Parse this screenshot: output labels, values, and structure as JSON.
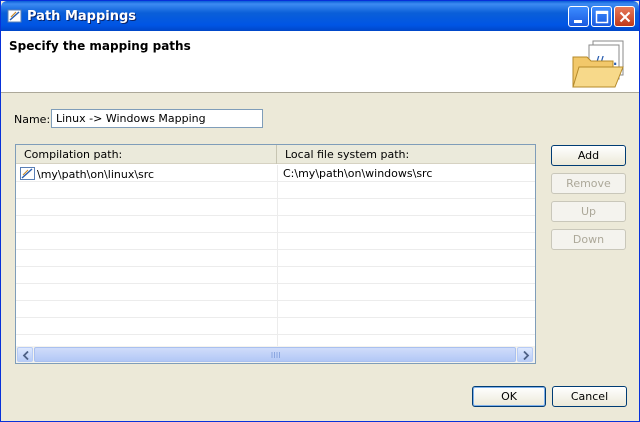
{
  "window": {
    "title": "Path Mappings",
    "icon": "path-mapping-app-icon",
    "controls": [
      "minimize-icon",
      "maximize-icon",
      "close-icon"
    ]
  },
  "banner": {
    "title": "Specify the mapping paths",
    "image": "folder-mapping-icon"
  },
  "name": {
    "label": "Name:",
    "value": "Linux -> Windows Mapping"
  },
  "table": {
    "columns": [
      "Compilation path:",
      "Local file system path:"
    ],
    "rows": [
      {
        "icon": "mapping-row-icon",
        "compilation": "\\my\\path\\on\\linux\\src",
        "local": "C:\\my\\path\\on\\windows\\src"
      },
      {
        "compilation": "",
        "local": ""
      },
      {
        "compilation": "",
        "local": ""
      },
      {
        "compilation": "",
        "local": ""
      },
      {
        "compilation": "",
        "local": ""
      },
      {
        "compilation": "",
        "local": ""
      },
      {
        "compilation": "",
        "local": ""
      },
      {
        "compilation": "",
        "local": ""
      },
      {
        "compilation": "",
        "local": ""
      },
      {
        "compilation": "",
        "local": ""
      },
      {
        "compilation": "",
        "local": ""
      }
    ]
  },
  "side_buttons": {
    "add": "Add",
    "remove": "Remove",
    "up": "Up",
    "down": "Down"
  },
  "footer": {
    "ok": "OK",
    "cancel": "Cancel"
  },
  "colors": {
    "titlebar": "#0a5fd8",
    "dialog_bg": "#ece9d8",
    "disabled_text": "#aca899"
  }
}
